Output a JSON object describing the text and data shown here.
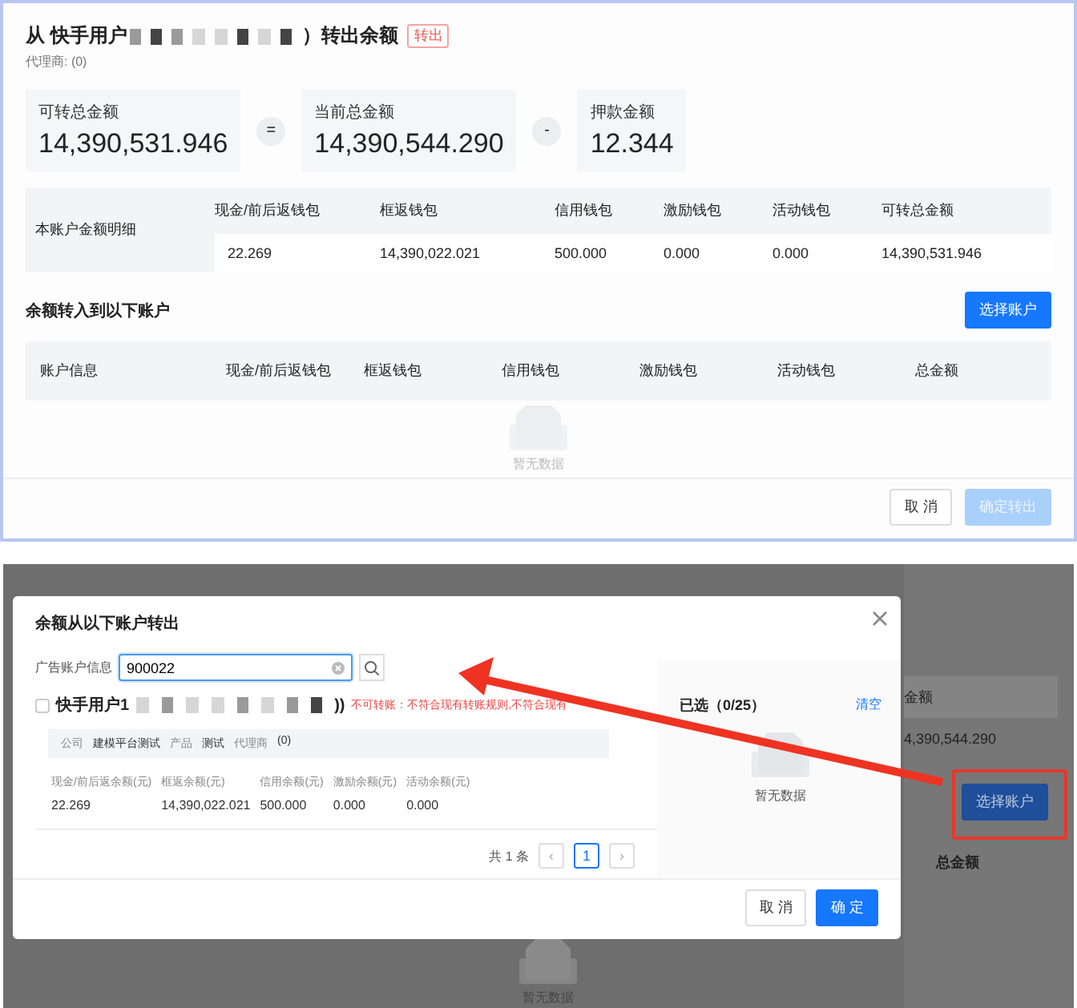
{
  "transfer_page": {
    "title_prefix": "从 快手用户",
    "title_suffix": "）转出余额",
    "tag": "转出",
    "agent": "代理商: (0)",
    "stats": [
      {
        "label": "可转总金额",
        "value": "14,390,531.946"
      },
      {
        "label": "当前总金额",
        "value": "14,390,544.290"
      },
      {
        "label": "押款金额",
        "value": "12.344"
      }
    ],
    "operators": [
      "=",
      "-"
    ],
    "detail": {
      "label": "本账户金额明细",
      "columns": [
        "现金/前后返钱包",
        "框返钱包",
        "信用钱包",
        "激励钱包",
        "活动钱包",
        "可转总金额"
      ],
      "values": [
        "22.269",
        "14,390,022.021",
        "500.000",
        "0.000",
        "0.000",
        "14,390,531.946"
      ]
    },
    "target": {
      "title": "余额转入到以下账户",
      "button": "选择账户",
      "columns": [
        "账户信息",
        "现金/前后返钱包",
        "框返钱包",
        "信用钱包",
        "激励钱包",
        "活动钱包",
        "总金额"
      ],
      "empty": "暂无数据"
    },
    "footer": {
      "cancel": "取 消",
      "confirm": "确定转出",
      "confirm_disabled": true
    }
  },
  "background_page": {
    "column_header": "金额",
    "total": "4,390,544.290",
    "button": "选择账户",
    "column_header_2": "总金额",
    "empty": "暂无数据"
  },
  "dialog": {
    "title": "余额从以下账户转出",
    "search": {
      "label": "广告账户信息",
      "value": "900022"
    },
    "account": {
      "checked": false,
      "name": "快手用户1",
      "name_end": "))",
      "warning": "不可转账：不符合现有转账规则,不符合现有",
      "info": [
        {
          "label": "公司",
          "value": "建模平台测试"
        },
        {
          "label": "产品",
          "value": "测试"
        },
        {
          "label": "代理商",
          "value": "(0)"
        }
      ],
      "metrics": [
        {
          "label": "现金/前后返余额(元)",
          "value": "22.269"
        },
        {
          "label": "框返余额(元)",
          "value": "14,390,022.021"
        },
        {
          "label": "信用余额(元)",
          "value": "500.000"
        },
        {
          "label": "激励余额(元)",
          "value": "0.000"
        },
        {
          "label": "活动余额(元)",
          "value": "0.000"
        }
      ]
    },
    "pagination": {
      "total": "共 1 条",
      "prev": "‹",
      "next": "›",
      "pages": [
        {
          "label": "1",
          "selected": true
        }
      ]
    },
    "selected_panel": {
      "title": "已选（0/25）",
      "clear": "清空",
      "empty": "暂无数据"
    },
    "footer": {
      "cancel": "取 消",
      "confirm": "确 定"
    }
  }
}
